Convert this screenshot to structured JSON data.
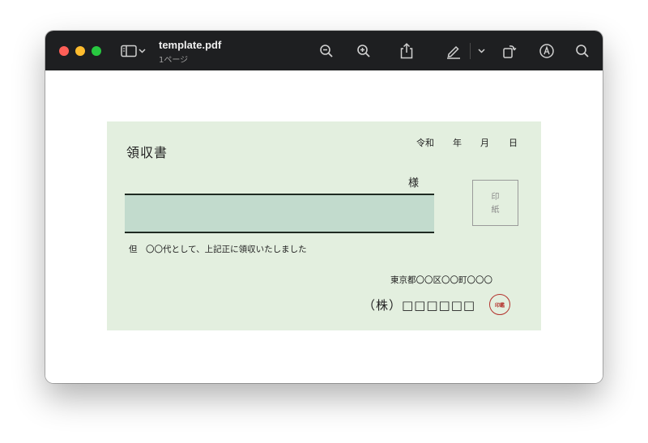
{
  "app": {
    "doc_title": "template.pdf",
    "page_indicator": "1ページ"
  },
  "toolbar": {
    "icons": [
      "sidebar-icon",
      "chevron-down-icon",
      "zoom-out-icon",
      "zoom-in-icon",
      "share-icon",
      "markup-pen-icon",
      "chevron-down-icon",
      "rotate-icon",
      "markup-circle-icon",
      "search-icon"
    ]
  },
  "receipt": {
    "title": "領収書",
    "era": "令和",
    "year": "年",
    "month": "月",
    "day": "日",
    "honorific": "様",
    "stamp_line1": "印",
    "stamp_line2": "紙",
    "note": "但　〇〇代として、上記正に領収いたしました",
    "address": "東京都〇〇区〇〇町〇〇〇",
    "company": "（株）□□□□□□",
    "seal_text": "印鑑"
  },
  "colors": {
    "titlebar": "#1e1f21",
    "receipt_bg": "#e3efdf",
    "amount_fill": "#c2dbcd",
    "seal": "#b3312c"
  }
}
